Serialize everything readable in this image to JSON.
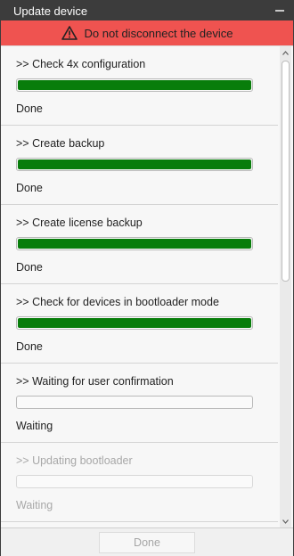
{
  "window": {
    "title": "Update device"
  },
  "warning": {
    "text": "Do not disconnect the device",
    "color": "#ef5350"
  },
  "steps": [
    {
      "label": ">> Check 4x configuration",
      "status": "Done",
      "progress": 1.0,
      "enabled": true
    },
    {
      "label": ">> Create backup",
      "status": "Done",
      "progress": 1.0,
      "enabled": true
    },
    {
      "label": ">> Create license backup",
      "status": "Done",
      "progress": 1.0,
      "enabled": true
    },
    {
      "label": ">> Check for devices in bootloader mode",
      "status": "Done",
      "progress": 1.0,
      "enabled": true
    },
    {
      "label": ">> Waiting for user confirmation",
      "status": "Waiting",
      "progress": 0.0,
      "enabled": true
    },
    {
      "label": ">> Updating bootloader",
      "status": "Waiting",
      "progress": 0.0,
      "enabled": false
    }
  ],
  "footer": {
    "done_label": "Done",
    "done_enabled": false
  },
  "colors": {
    "progress_fill": "#087d0b",
    "titlebar": "#3c3c3c"
  }
}
